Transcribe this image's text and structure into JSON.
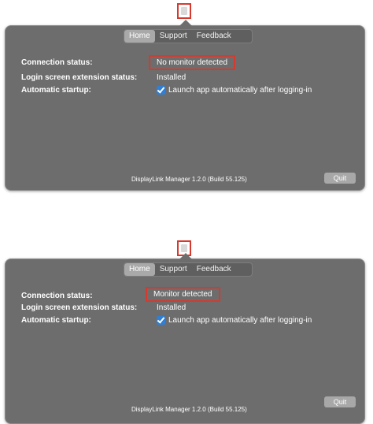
{
  "tabs": [
    "Home",
    "Support",
    "Feedback"
  ],
  "labels": {
    "connection": "Connection status:",
    "login_ext": "Login screen extension status:",
    "startup": "Automatic startup:"
  },
  "values": {
    "login_ext": "Installed",
    "launch_checkbox": "Launch app automatically after logging-in",
    "launch_checked": true
  },
  "footer": {
    "version": "DisplayLink Manager 1.2.0 (Build 55.125)"
  },
  "buttons": {
    "quit": "Quit"
  },
  "panels": [
    {
      "connection_status": "No monitor detected"
    },
    {
      "connection_status": "Monitor detected"
    }
  ],
  "colors": {
    "highlight_box": "#d63a2f",
    "window_bg": "#6d6d6d",
    "checkbox": "#2f7fd6"
  },
  "icons": {
    "menubar": "displaylink-menubar-icon",
    "checkbox": "checkmark-icon"
  }
}
